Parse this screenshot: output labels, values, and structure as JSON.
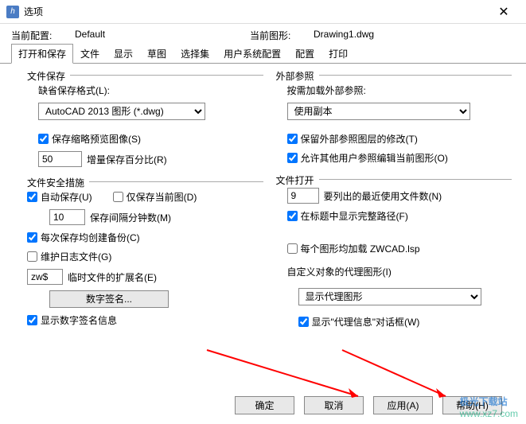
{
  "titlebar": {
    "title": "选项",
    "close": "✕"
  },
  "header": {
    "curr_profile_lbl": "当前配置:",
    "curr_profile_val": "Default",
    "curr_drawing_lbl": "当前图形:",
    "curr_drawing_val": "Drawing1.dwg"
  },
  "tabs": [
    "打开和保存",
    "文件",
    "显示",
    "草图",
    "选择集",
    "用户系统配置",
    "配置",
    "打印"
  ],
  "active_tab": 0,
  "left": {
    "filesave_title": "文件保存",
    "default_fmt_lbl": "缺省保存格式(L):",
    "default_fmt_val": "AutoCAD 2013 图形 (*.dwg)",
    "thumb_chk": "保存缩略预览图像(S)",
    "incr_val": "50",
    "incr_lbl": "增量保存百分比(R)",
    "safety_title": "文件安全措施",
    "autosave_chk": "自动保存(U)",
    "onlycurr_chk": "仅保存当前图(D)",
    "interval_val": "10",
    "interval_lbl": "保存间隔分钟数(M)",
    "backup_chk": "每次保存均创建备份(C)",
    "log_chk": "维护日志文件(G)",
    "tmpext_val": "zw$",
    "tmpext_lbl": "临时文件的扩展名(E)",
    "sig_btn": "数字签名...",
    "showsig_chk": "显示数字签名信息"
  },
  "right": {
    "xref_title": "外部参照",
    "xref_lbl": "按需加载外部参照:",
    "xref_val": "使用副本",
    "keeplayer_chk": "保留外部参照图层的修改(T)",
    "allowedit_chk": "允许其他用户参照编辑当前图形(O)",
    "open_title": "文件打开",
    "recent_val": "9",
    "recent_lbl": "要列出的最近使用文件数(N)",
    "fullpath_chk": "在标题中显示完整路径(F)",
    "loadlsp_chk": "每个图形均加载 ZWCAD.lsp",
    "proxy_lbl": "自定义对象的代理图形(I)",
    "proxy_val": "显示代理图形",
    "proxyinfo_chk": "显示\"代理信息\"对话框(W)"
  },
  "footer": {
    "ok": "确定",
    "cancel": "取消",
    "apply": "应用(A)",
    "help": "帮助(H)"
  },
  "watermark": {
    "a": "极光下载站",
    "b": "www.xz7.com"
  }
}
